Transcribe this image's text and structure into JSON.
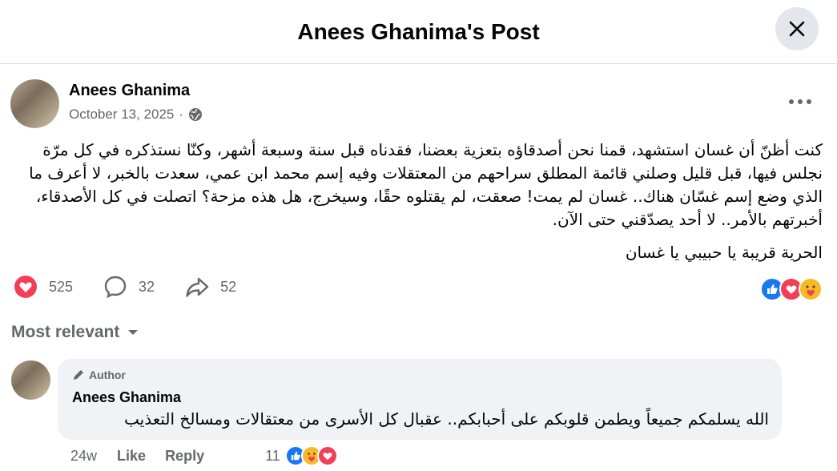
{
  "header": {
    "title": "Anees Ghanima's Post",
    "close_icon": "close-icon"
  },
  "post": {
    "author": "Anees Ghanima",
    "date": "October 13, 2025",
    "separator": "·",
    "audience_icon": "globe-icon",
    "body": [
      "كنت أظنّ أن غسان استشهد، قمنا نحن أصدقاؤه بتعزية بعضنا، فقدناه قبل سنة وسبعة أشهر، وكنّا نستذكره في كل مرّة نجلس فيها، قبل قليل وصلني قائمة المطلق سراحهم من المعتقلات وفيه إسم محمد ابن عمي، سعدت بالخبر، لا أعرف ما الذي وضع إسم غسّان هناك.. غسان لم يمت! صعقت، لم يقتلوه حقًا، وسيخرج، هل هذه مزحة؟ اتصلت في كل الأصدقاء، أخبرتهم بالأمر.. لا أحد يصدّقني حتى الآن."
    ],
    "closing": "الحرية قريبة يا حبيبي يا غسان"
  },
  "stats": {
    "reactions": "525",
    "comments": "32",
    "shares": "52"
  },
  "reaction_types": [
    "like",
    "love",
    "care"
  ],
  "sort": {
    "label": "Most relevant"
  },
  "comment": {
    "badge": "Author",
    "name": "Anees Ghanima",
    "text": "الله يسلمكم جميعاً ويطمن قلوبكم على أحبابكم.. عقبال كل الأسرى من معتقالات ومسالخ التعذيب",
    "time": "24w",
    "like": "Like",
    "reply": "Reply",
    "reaction_count": "11",
    "reaction_types": [
      "like",
      "care",
      "love"
    ]
  },
  "colors": {
    "like": "#1877f2",
    "love": "#f33e58",
    "care": "#f7b928",
    "secondary_text": "#65676b",
    "bubble": "#f0f2f5"
  }
}
